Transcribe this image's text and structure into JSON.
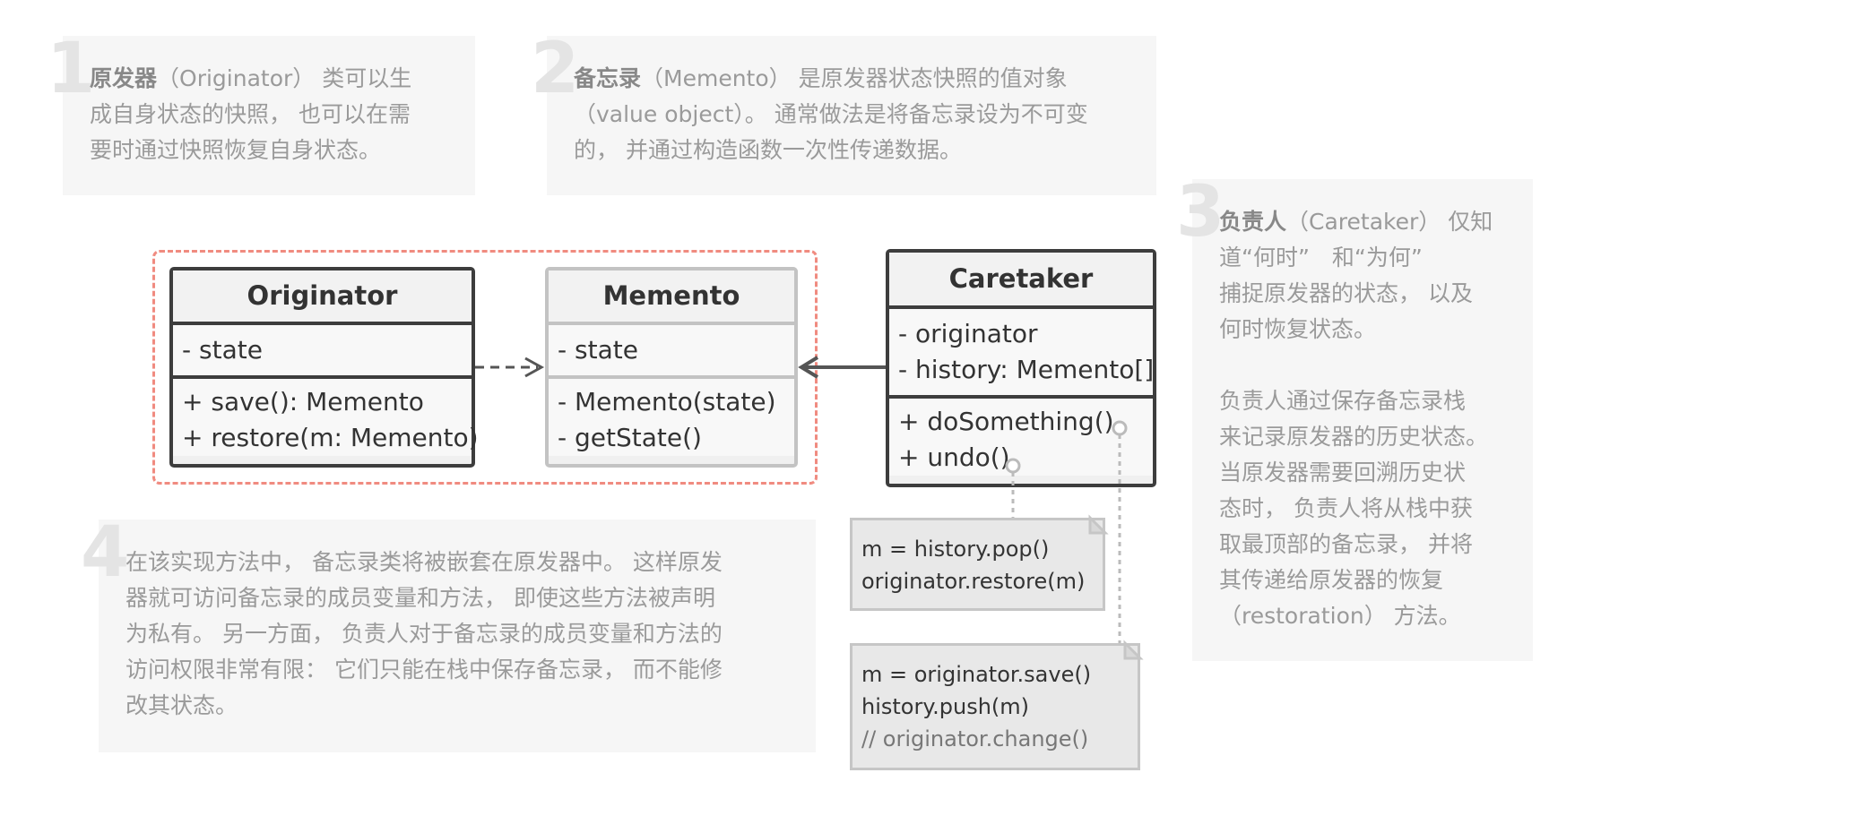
{
  "notes": {
    "n1": {
      "number": "1",
      "bold": "原发器",
      "lines": [
        "（Originator） 类可以生",
        "成自身状态的快照， 也可以在需",
        "要时通过快照恢复自身状态。"
      ]
    },
    "n2": {
      "number": "2",
      "bold": "备忘录",
      "lines": [
        "（Memento） 是原发器状态快照的值对象",
        "（value object）。 通常做法是将备忘录设为不可变",
        "的， 并通过构造函数一次性传递数据。"
      ]
    },
    "n3": {
      "number": "3",
      "bold": "负责人",
      "lines": [
        "（Caretaker） 仅知",
        "道“何时”　和“为何”",
        "捕捉原发器的状态， 以及",
        "何时恢复状态。"
      ],
      "lines2": [
        "负责人通过保存备忘录栈",
        "来记录原发器的历史状态。",
        "当原发器需要回溯历史状",
        "态时， 负责人将从栈中获",
        "取最顶部的备忘录， 并将",
        "其传递给原发器的恢复",
        "（restoration） 方法。"
      ]
    },
    "n4": {
      "number": "4",
      "lines": [
        "在该实现方法中， 备忘录类将被嵌套在原发器中。 这样原发",
        "器就可访问备忘录的成员变量和方法， 即使这些方法被声明",
        "为私有。 另一方面， 负责人对于备忘录的成员变量和方法的",
        "访问权限非常有限： 它们只能在栈中保存备忘录， 而不能修",
        "改其状态。"
      ]
    }
  },
  "classes": {
    "originator": {
      "name": "Originator",
      "fields": [
        "- state"
      ],
      "methods": [
        "+ save(): Memento",
        "+ restore(m: Memento)"
      ]
    },
    "memento": {
      "name": "Memento",
      "fields": [
        "- state"
      ],
      "methods": [
        "- Memento(state)",
        "- getState()"
      ]
    },
    "caretaker": {
      "name": "Caretaker",
      "fields": [
        "- originator",
        "- history: Memento[]"
      ],
      "methods": [
        "+ doSomething()",
        "+ undo()"
      ]
    }
  },
  "code_notes": {
    "undo": [
      "m = history.pop()",
      "originator.restore(m)"
    ],
    "do_something": [
      "m = originator.save()",
      "history.push(m)"
    ],
    "do_something_comment": "// originator.change()"
  },
  "colors": {
    "frame_dashed": "#f08b80",
    "box_border": "#3d3d3d",
    "box_border_light": "#c3c3c3",
    "note_bg": "#f6f6f6",
    "note_text": "#9a9a9a"
  }
}
